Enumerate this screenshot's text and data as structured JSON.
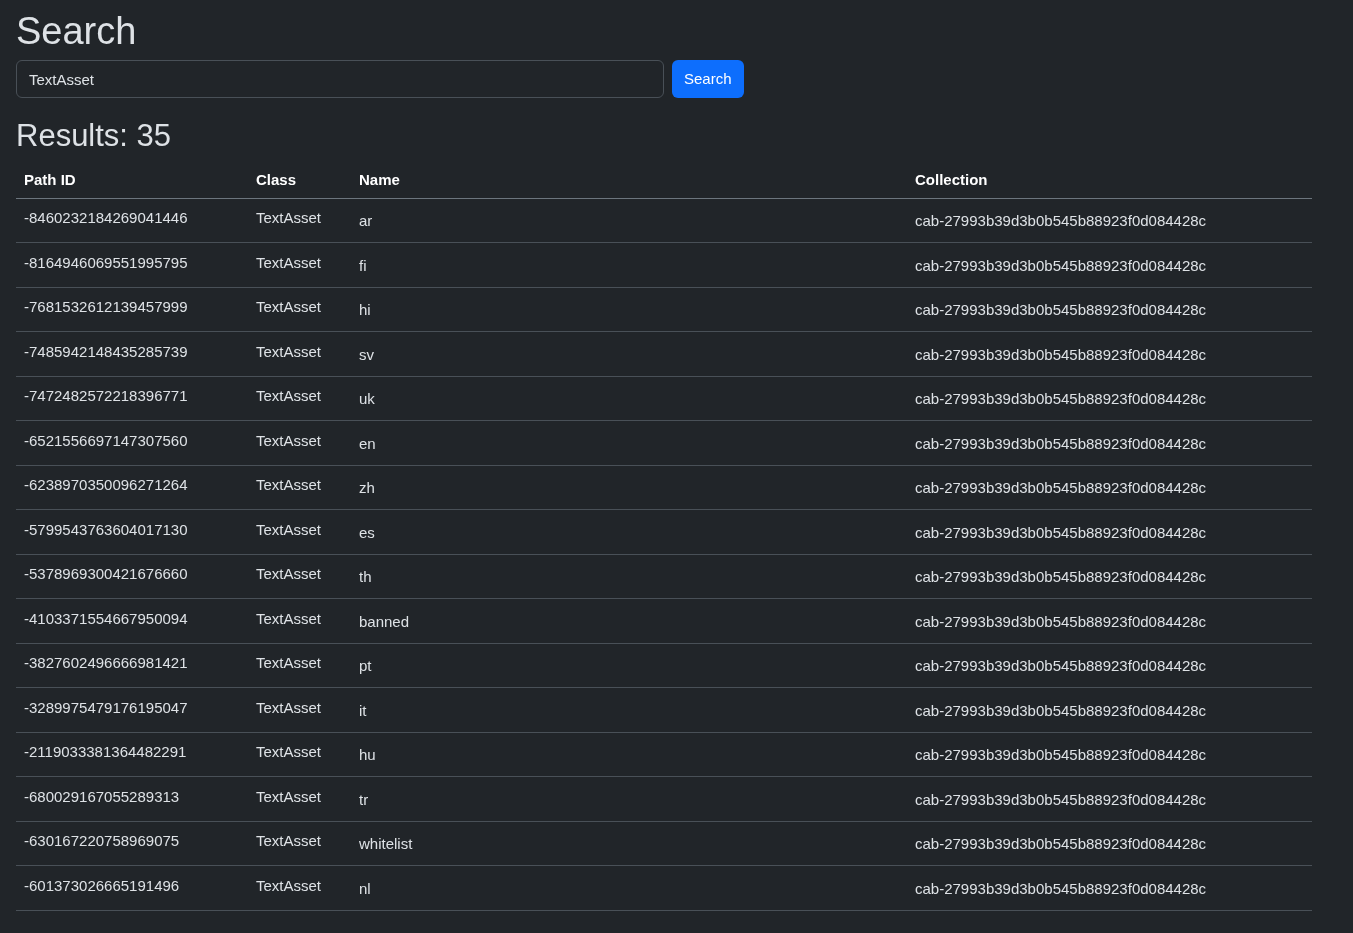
{
  "title": "Search",
  "search": {
    "value": "TextAsset",
    "button": "Search"
  },
  "results_heading": "Results: 35",
  "table": {
    "columns": [
      "Path ID",
      "Class",
      "Name",
      "Collection"
    ],
    "rows": [
      [
        "-8460232184269041446",
        "TextAsset",
        "ar",
        "cab-27993b39d3b0b545b88923f0d084428c"
      ],
      [
        "-8164946069551995795",
        "TextAsset",
        "fi",
        "cab-27993b39d3b0b545b88923f0d084428c"
      ],
      [
        "-7681532612139457999",
        "TextAsset",
        "hi",
        "cab-27993b39d3b0b545b88923f0d084428c"
      ],
      [
        "-7485942148435285739",
        "TextAsset",
        "sv",
        "cab-27993b39d3b0b545b88923f0d084428c"
      ],
      [
        "-7472482572218396771",
        "TextAsset",
        "uk",
        "cab-27993b39d3b0b545b88923f0d084428c"
      ],
      [
        "-6521556697147307560",
        "TextAsset",
        "en",
        "cab-27993b39d3b0b545b88923f0d084428c"
      ],
      [
        "-6238970350096271264",
        "TextAsset",
        "zh",
        "cab-27993b39d3b0b545b88923f0d084428c"
      ],
      [
        "-5799543763604017130",
        "TextAsset",
        "es",
        "cab-27993b39d3b0b545b88923f0d084428c"
      ],
      [
        "-5378969300421676660",
        "TextAsset",
        "th",
        "cab-27993b39d3b0b545b88923f0d084428c"
      ],
      [
        "-4103371554667950094",
        "TextAsset",
        "banned",
        "cab-27993b39d3b0b545b88923f0d084428c"
      ],
      [
        "-3827602496666981421",
        "TextAsset",
        "pt",
        "cab-27993b39d3b0b545b88923f0d084428c"
      ],
      [
        "-3289975479176195047",
        "TextAsset",
        "it",
        "cab-27993b39d3b0b545b88923f0d084428c"
      ],
      [
        "-2119033381364482291",
        "TextAsset",
        "hu",
        "cab-27993b39d3b0b545b88923f0d084428c"
      ],
      [
        "-680029167055289313",
        "TextAsset",
        "tr",
        "cab-27993b39d3b0b545b88923f0d084428c"
      ],
      [
        "-630167220758969075",
        "TextAsset",
        "whitelist",
        "cab-27993b39d3b0b545b88923f0d084428c"
      ],
      [
        "-601373026665191496",
        "TextAsset",
        "nl",
        "cab-27993b39d3b0b545b88923f0d084428c"
      ]
    ]
  }
}
